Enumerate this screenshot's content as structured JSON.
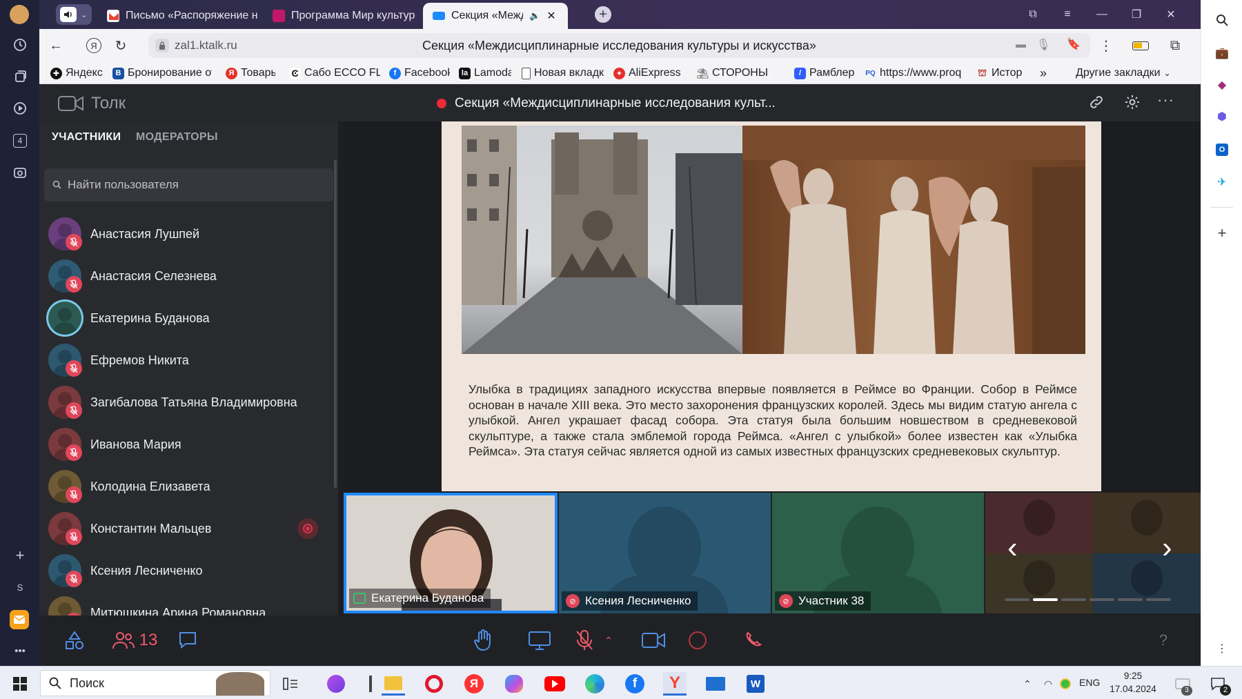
{
  "browser": {
    "tabs": [
      {
        "label": "Письмо «Распоряжение н"
      },
      {
        "label": "Программа Мир культуры"
      },
      {
        "label": "Секция «Междисци"
      }
    ],
    "url": "zal1.ktalk.ru",
    "page_title": "Секция «Междисциплинарные исследования культуры и искусства»",
    "bookmarks": [
      "Яндекс",
      "Бронирование от",
      "Товары",
      "Сабо ECCO FLOW",
      "Facebook",
      "Lamoda",
      "Новая вкладка",
      "AliExpress",
      "СТОРОНЫ",
      "Рамблер",
      "https://www.proq",
      "Истор"
    ],
    "bookmarks_more": "»",
    "other_bookmarks": "Другие закладки",
    "sidebar_badge_4": "4",
    "sidebar_letter_s": "S"
  },
  "app": {
    "brand": "Толк",
    "meeting_title": "Секция «Междисциплинарные исследования культ...",
    "panel_tabs": {
      "participants": "УЧАСТНИКИ",
      "moderators": "МОДЕРАТОРЫ"
    },
    "search_placeholder": "Найти пользователя",
    "participants": [
      {
        "name": "Анастасия Лушпей",
        "muted": true,
        "color": "#6b3f7e"
      },
      {
        "name": "Анастасия Селезнева",
        "muted": true,
        "color": "#2f5a74"
      },
      {
        "name": "Екатерина Буданова",
        "muted": false,
        "speaking": true,
        "color": "#2c5a52"
      },
      {
        "name": "Ефремов Никита",
        "muted": true,
        "color": "#2d5870"
      },
      {
        "name": "Загибалова Татьяна Владимировна",
        "muted": true,
        "color": "#7a3a3e"
      },
      {
        "name": "Иванова Мария",
        "muted": true,
        "color": "#7a3a3e"
      },
      {
        "name": "Колодина Елизавета",
        "muted": true,
        "color": "#6e5a34"
      },
      {
        "name": "Константин Мальцев",
        "muted": true,
        "recording": true,
        "color": "#7a3a3e"
      },
      {
        "name": "Ксения Лесниченко",
        "muted": true,
        "color": "#2d5870"
      },
      {
        "name": "Митюшкина Арина Романовна",
        "muted": true,
        "color": "#6e5a34"
      }
    ],
    "slide_text": "Улыбка в традициях западного искусства впервые появляется в Реймсе во Франции. Собор в Реймсе основан в начале XIII века. Это место захоронения французских королей. Здесь мы видим статую ангела с улыбкой. Ангел украшает фасад собора. Эта статуя была большим новшеством в средневековой скульптуре, а также стала эмблемой города Реймса. «Ангел с улыбкой» более известен как «Улыбка Реймса». Эта статуя сейчас является одной из самых известных французских средневековых скульптур.",
    "video_tiles": [
      {
        "name": "Екатерина Буданова",
        "status": "screen-share"
      },
      {
        "name": "Ксения Лесниченко",
        "status": "muted"
      },
      {
        "name": "Участник 38",
        "status": "muted"
      }
    ],
    "participants_count": "13",
    "help": "?"
  },
  "taskbar": {
    "search_label": "Поиск",
    "lang": "ENG",
    "time": "9:25",
    "date": "17.04.2024",
    "notif_count": "2",
    "badge_3": "3"
  },
  "colors": {
    "accent_blue": "#1e88ff",
    "mute_red": "#e0475a",
    "record_red": "#e0334a"
  }
}
